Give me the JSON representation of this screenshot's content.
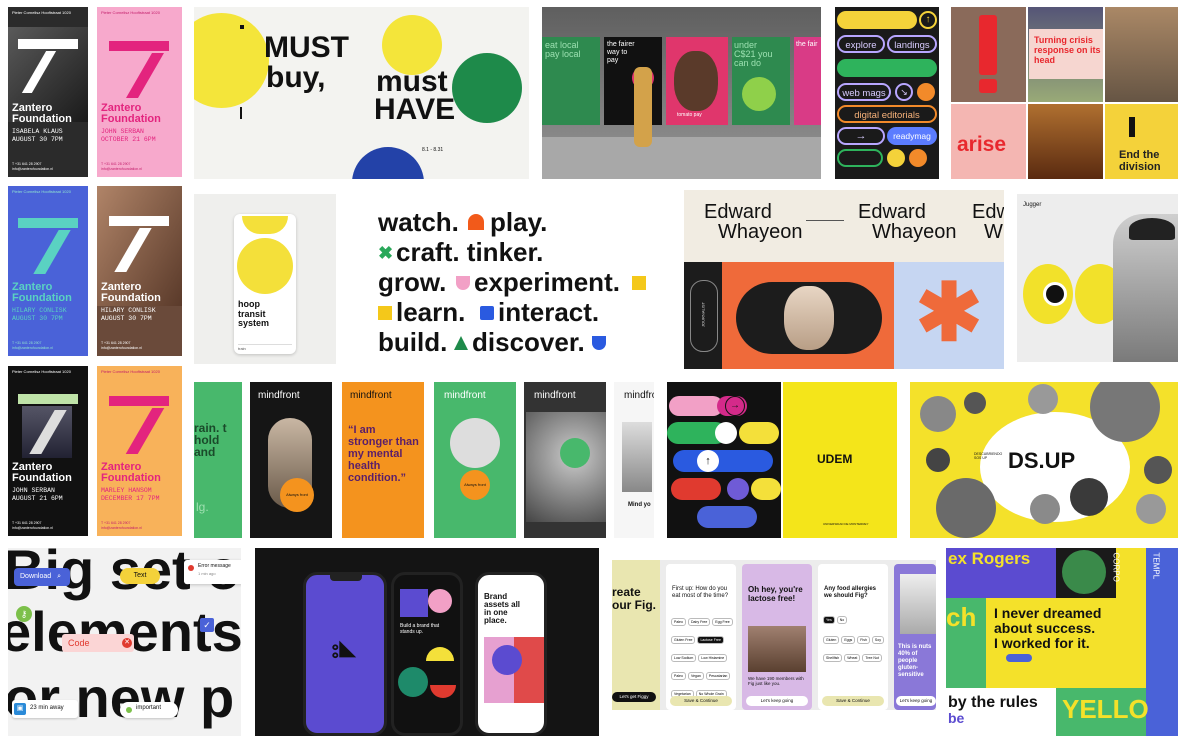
{
  "zantero": {
    "top_line": "Pieter Cornelisz Hooftstraat 1020",
    "top_line2": "Amsterdam, Nederland",
    "title1": "Zantero",
    "title2": "Foundation",
    "posters": [
      {
        "name": "ISABELA KLAUS",
        "date": "AUGUST 30 7PM"
      },
      {
        "name": "JOHN SERBAN",
        "date": "OCTOBER 21 6PM"
      },
      {
        "name": "HILARY CONLISK",
        "date": "AUGUST 30 7PM"
      },
      {
        "name": "HILARY CONLISK",
        "date": "AUGUST 30 7PM"
      },
      {
        "name": "JOHN SERBAN",
        "date": "AUGUST 21 6PM"
      },
      {
        "name": "MARLEY HANSOM",
        "date": "DECEMBER 17 7PM"
      }
    ],
    "phone": "T +31 641 28 2907",
    "email": "info@zanterofoundation.nl",
    "web": "www.zanterofoundation.nl"
  },
  "mustbuy": {
    "line1": "MUST",
    "line2": "buy,",
    "line3": "must",
    "line4": "HAVE",
    "small": "8.1 - 8.31"
  },
  "tomato": {
    "panels": [
      "eat local pay local",
      "the fairer way to pay",
      "under C$21 you can do",
      "the fair"
    ],
    "brand": "tomato pay"
  },
  "webmags": {
    "buttons": [
      "explore",
      "landings",
      "web mags",
      "digital editorials",
      "readymag"
    ]
  },
  "arise": {
    "headline": "Turning crisis response on its head",
    "logo": "arise",
    "tagline": "End the division",
    "small": "arise"
  },
  "hoop": {
    "name": "hoop transit system",
    "small": "train"
  },
  "watch": {
    "lines": [
      "watch.",
      "play.",
      "craft. tinker.",
      "grow.",
      "experiment.",
      "learn.",
      "interact.",
      "build.",
      "discover."
    ]
  },
  "edward": {
    "name1": "Edward",
    "name2": "Whayeon",
    "name3": "Edw",
    "name4": "W",
    "vertical": "JOURNALIST"
  },
  "jugger": {
    "label": "Jugger"
  },
  "mindfront": {
    "brand": "mindfront",
    "quote": "“I am stronger than my mental health condition.”",
    "left_text": "rain. t hold and",
    "cta": "Always front",
    "mind_you": "Mind yo",
    "small": "lg."
  },
  "udem": {
    "title": "UDEM",
    "small": "UNIVERSIDAD DE MONTERREY"
  },
  "dsup": {
    "title": "DS.UP",
    "small": "DESCUBRIENDO SOS UP"
  },
  "elements": {
    "line1": "Big set of",
    "line2": "elements",
    "line3": "or new p",
    "download": "Download",
    "text_chip": "Text",
    "error": "Error message",
    "error_sub": "1 min ago",
    "code": "Code",
    "time": "23 min away",
    "important": "important"
  },
  "phones": {
    "middle_text": "Build a brand that stands up.",
    "right_text": "Brand assets all in one place."
  },
  "fig": {
    "left_title": "reate our Fig.",
    "left_btn": "Let's get Figgy",
    "card1_q": "First up: How do you eat most of the time?",
    "card1_chips": [
      "Paleo",
      "Dairy Free",
      "Egg Free",
      "Gluten Free",
      "Lactose Free",
      "Low Sodium",
      "Low Histamine",
      "Paleo",
      "Vegan",
      "Pescatarian",
      "Vegetarian",
      "No Whole Grain"
    ],
    "card1_btn": "Save & Continue",
    "card2_title": "Oh hey, you're lactose free!",
    "card2_body": "We have 190 members with Fig just like you.",
    "card2_btn": "Let's keep going",
    "card3_q": "Any food allergies we should Fig?",
    "card3_opts": [
      "Yes",
      "No"
    ],
    "card3_chips": [
      "Gluten",
      "Eggs",
      "Fish",
      "Soy",
      "Shellfish",
      "Wheat",
      "Tree Nut"
    ],
    "card3_btn": "Save & Continue",
    "card4_text": "This is nuts 40% of people gluten-sensitive",
    "card4_btn": "Let's keep going"
  },
  "rogers": {
    "name": "ex Rogers",
    "quote1": "I never dreamed",
    "quote2": "about success.",
    "quote3": "I worked for it.",
    "rules": "by the rules",
    "be": "be",
    "yellow": "YELLO",
    "ch": "ch",
    "side1": "CORPO",
    "side2": "TEMPL"
  },
  "colors": {
    "yellow": "#f5e43a",
    "pink": "#f39dc8",
    "magenta": "#e3247e",
    "blue": "#4a62d8",
    "green": "#33b56a",
    "orange": "#f4931e",
    "red": "#e03a2f",
    "black": "#111111",
    "purple": "#6f5bd6"
  }
}
